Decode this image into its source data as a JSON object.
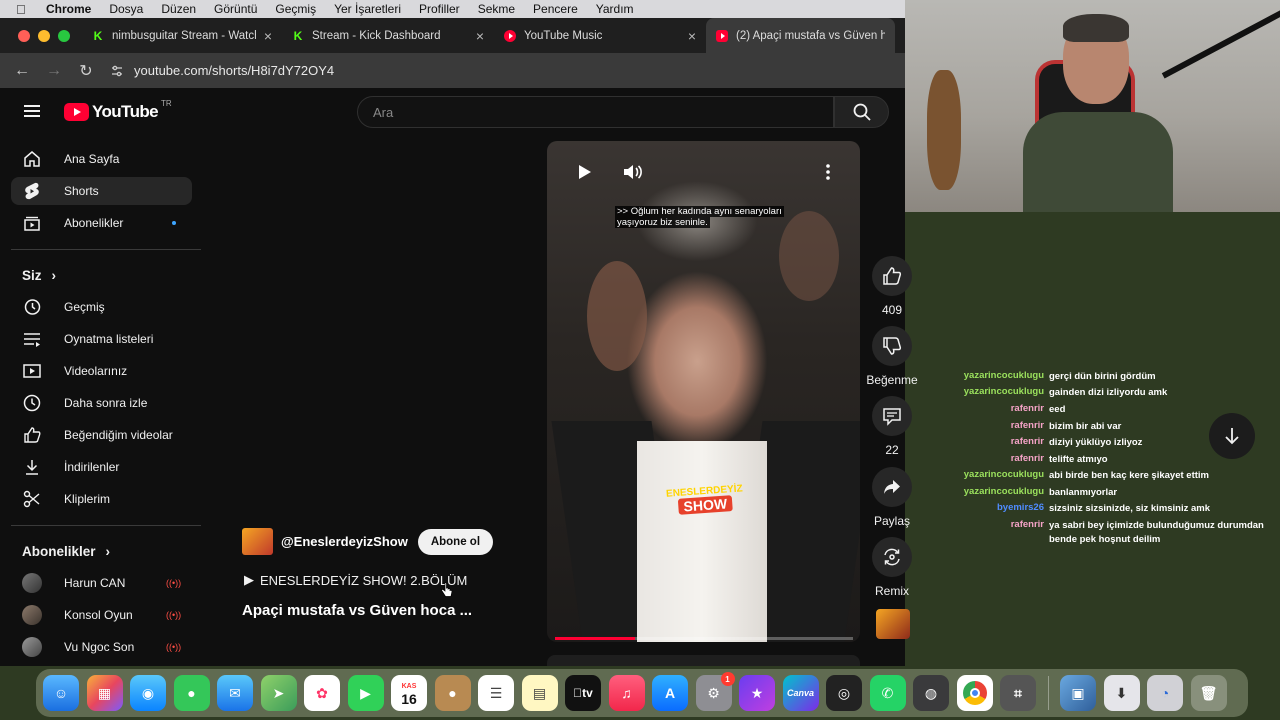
{
  "menubar": {
    "app_name": "Chrome",
    "items": [
      "Dosya",
      "Düzen",
      "Görüntü",
      "Geçmiş",
      "Yer İşaretleri",
      "Profiller",
      "Sekme",
      "Pencere",
      "Yardım"
    ]
  },
  "browser": {
    "tabs": [
      {
        "title": "nimbusguitar Stream - Watch",
        "favicon": "kick-icon"
      },
      {
        "title": "Stream - Kick Dashboard",
        "favicon": "kick-icon"
      },
      {
        "title": "YouTube Music",
        "favicon": "youtube-music-icon"
      },
      {
        "title": "(2) Apaçi mustafa vs Güven h",
        "favicon": "youtube-icon"
      }
    ],
    "url": "youtube.com/shorts/H8i7dY72OY4"
  },
  "youtube": {
    "logo_text": "YouTube",
    "country_code": "TR",
    "search_placeholder": "Ara",
    "sidebar": {
      "main": [
        {
          "label": "Ana Sayfa",
          "icon": "home-icon"
        },
        {
          "label": "Shorts",
          "icon": "shorts-icon"
        },
        {
          "label": "Abonelikler",
          "icon": "subscriptions-icon"
        }
      ],
      "you_section": "Siz",
      "you_items": [
        {
          "label": "Geçmiş",
          "icon": "history-icon"
        },
        {
          "label": "Oynatma listeleri",
          "icon": "playlists-icon"
        },
        {
          "label": "Videolarınız",
          "icon": "your-videos-icon"
        },
        {
          "label": "Daha sonra izle",
          "icon": "watch-later-icon"
        },
        {
          "label": "Beğendiğim videolar",
          "icon": "liked-icon"
        },
        {
          "label": "İndirilenler",
          "icon": "downloads-icon"
        },
        {
          "label": "Kliplerim",
          "icon": "clips-icon"
        }
      ],
      "subs_section": "Abonelikler",
      "subscriptions": [
        {
          "label": "Harun CAN"
        },
        {
          "label": "Konsol Oyun"
        },
        {
          "label": "Vu Ngoc Son"
        }
      ]
    },
    "short": {
      "caption_line1": ">> Oğlum her kadında aynı senaryoları",
      "caption_line2": "yaşıyoruz biz seninle.",
      "logo_line1": "ENESLERDEYİZ",
      "logo_line2": "SHOW",
      "channel_handle": "@EneslerdeyizShow",
      "subscribe_label": "Abone ol",
      "playlist_label": "ENESLERDEYİZ SHOW! 2.BÖLÜM",
      "title": "Apaçi mustafa vs Güven hoca ...",
      "progress": 0.27
    },
    "actions": {
      "like_count": "409",
      "dislike_label": "Beğenme",
      "comment_count": "22",
      "share_label": "Paylaş",
      "remix_label": "Remix"
    }
  },
  "chat": [
    {
      "user": "yazarincocuklugu",
      "msg": "gerçi dün birini gördüm",
      "color": "#9be15d"
    },
    {
      "user": "yazarincocuklugu",
      "msg": "gainden dizi izliyordu amk",
      "color": "#9be15d"
    },
    {
      "user": "rafenrir",
      "msg": "eed",
      "color": "#f5a3c7"
    },
    {
      "user": "rafenrir",
      "msg": "bizim bir abi var",
      "color": "#f5a3c7"
    },
    {
      "user": "rafenrir",
      "msg": "diziyi yüklüyo izliyoz",
      "color": "#f5a3c7"
    },
    {
      "user": "rafenrir",
      "msg": "telifte atmıyo",
      "color": "#f5a3c7"
    },
    {
      "user": "yazarincocuklugu",
      "msg": "abi birde ben kaç kere şikayet ettim",
      "color": "#9be15d"
    },
    {
      "user": "yazarincocuklugu",
      "msg": "banlanmıyorlar",
      "color": "#9be15d"
    },
    {
      "user": "byemirs26",
      "msg": "sizsiniz sizsinizde, siz kimsiniz amk",
      "color": "#4f8cff"
    },
    {
      "user": "rafenrir",
      "msg": "ya sabri bey içimizde bulunduğumuz durumdan bende pek hoşnut deilim",
      "color": "#f5a3c7"
    }
  ],
  "dock": {
    "calendar_month": "KAS",
    "calendar_day": "16",
    "settings_badge": "1",
    "tv_label": "tv",
    "canva_label": "Canva"
  }
}
